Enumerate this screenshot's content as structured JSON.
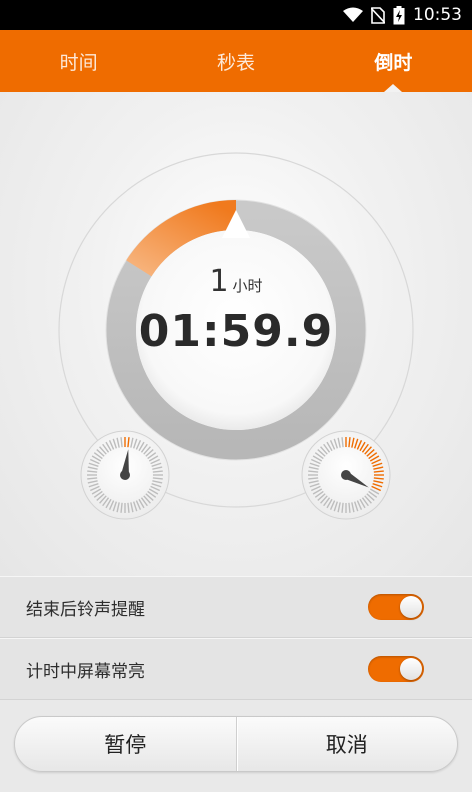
{
  "status_bar": {
    "time": "10:53",
    "icons": [
      "wifi-icon",
      "no-sim-icon",
      "battery-charging-icon"
    ]
  },
  "tabs": [
    {
      "label": "时间",
      "active": false
    },
    {
      "label": "秒表",
      "active": false
    },
    {
      "label": "倒时",
      "active": true
    }
  ],
  "timer": {
    "hours_value": "1",
    "hours_unit": "小时",
    "display": "01:59.9",
    "main_ring_progress": 0.16,
    "left_dial_progress": 0.02,
    "right_dial_progress": 0.33,
    "accent_color": "#ef6c00"
  },
  "settings": [
    {
      "label": "结束后铃声提醒",
      "enabled": true
    },
    {
      "label": "计时中屏幕常亮",
      "enabled": true
    }
  ],
  "buttons": {
    "pause": "暂停",
    "cancel": "取消"
  },
  "colors": {
    "accent": "#ef6c00",
    "status_bar": "#000000"
  }
}
